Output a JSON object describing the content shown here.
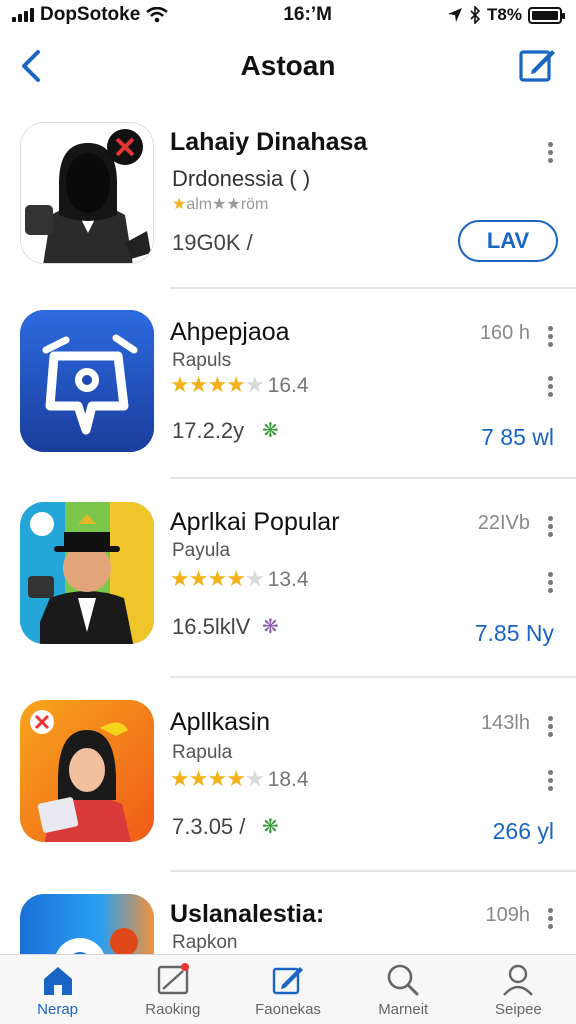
{
  "status_bar": {
    "carrier": "DopSotoke",
    "time": "16:’M",
    "battery": "T8%"
  },
  "nav": {
    "title": "Astoan"
  },
  "apps": [
    {
      "name": "Lahaiy Dinahasa",
      "subtitle": "Drdonessia ( )",
      "stars_text": "alm★★röm",
      "size": "19G0K /",
      "action_label": "LAV"
    },
    {
      "name": "Ahpepjaoa",
      "subtitle": "Rapuls",
      "rating": 3.5,
      "rating_count": "16.4",
      "size": "17.2.2y",
      "side_text": "160 h",
      "price": "7 85 wl"
    },
    {
      "name": "Aprlkai Popular",
      "subtitle": "Payula",
      "rating": 3.5,
      "rating_count": "13.4",
      "size": "16.5lklV",
      "side_text": "22IVb",
      "price": "7.85 Ny"
    },
    {
      "name": "Apllkasin",
      "subtitle": "Rapula",
      "rating": 3.5,
      "rating_count": "18.4",
      "size": "7.3.05 /",
      "side_text": "143lh",
      "price": "266 yl"
    },
    {
      "name": "Uslanalestia:",
      "subtitle": "Rapkon",
      "side_text": "109h"
    }
  ],
  "tabs": [
    {
      "label": "Nerap",
      "icon": "home-icon",
      "active": true
    },
    {
      "label": "Raoking",
      "icon": "chart-icon",
      "active": false
    },
    {
      "label": "Faonekas",
      "icon": "compose-icon",
      "active": false
    },
    {
      "label": "Marneit",
      "icon": "search-icon",
      "active": false
    },
    {
      "label": "Seipee",
      "icon": "person-icon",
      "active": false
    }
  ],
  "colors": {
    "accent": "#1a64c4",
    "star": "#f3b21b"
  }
}
